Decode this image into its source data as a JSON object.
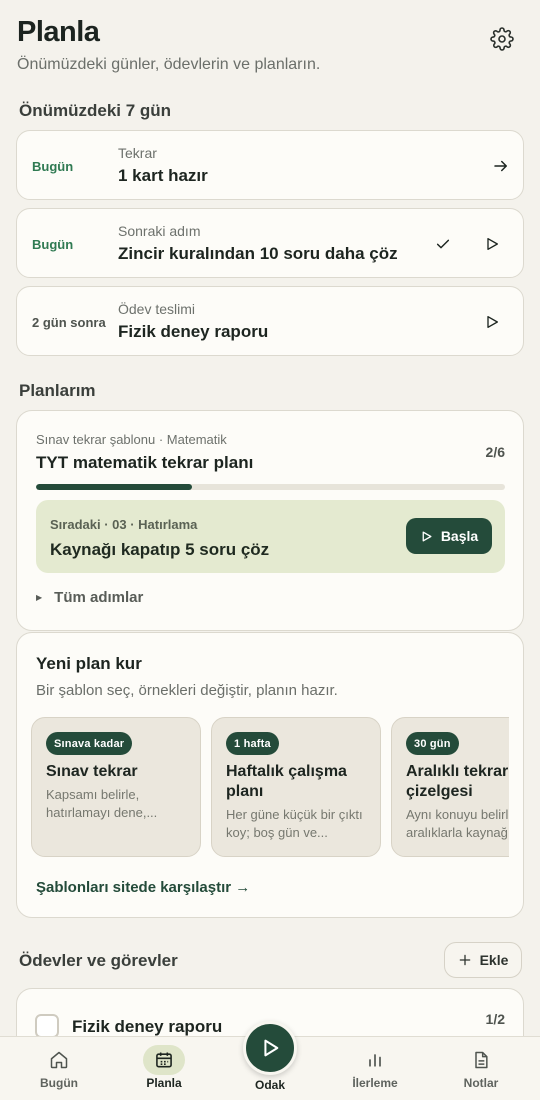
{
  "header": {
    "title": "Planla",
    "subtitle": "Önümüzdeki günler, ödevlerin ve planların.",
    "settings_icon": "gear-icon"
  },
  "upcoming": {
    "title": "Önümüzdeki 7 gün",
    "items": [
      {
        "when": "Bugün",
        "kicker": "Tekrar",
        "main": "1 kart hazır"
      },
      {
        "when": "Bugün",
        "kicker": "Sonraki adım",
        "main": "Zincir kuralından 10 soru daha çöz"
      },
      {
        "when": "2 gün sonra",
        "kicker": "Ödev teslimi",
        "main": "Fizik deney raporu"
      }
    ]
  },
  "plans": {
    "title": "Planlarım",
    "plan": {
      "kicker": "Sınav tekrar şablonu · Matematik",
      "name": "TYT matematik tekrar planı",
      "count": "2/6",
      "progress": 0.333,
      "next_kicker": "Sıradaki · 03 · Hatırlama",
      "next_main": "Kaynağı kapatıp 5 soru çöz",
      "start_label": "Başla",
      "all_steps_label": "Tüm adımlar"
    }
  },
  "new_plan": {
    "title": "Yeni plan kur",
    "subtitle": "Bir şablon seç, örnekleri değiştir, planın hazır.",
    "templates": [
      {
        "badge": "Sınava kadar",
        "name": "Sınav tekrar",
        "desc": "Kapsamı belirle, hatırlamayı dene,..."
      },
      {
        "badge": "1 hafta",
        "name": "Haftalık çalışma planı",
        "desc": "Her güne küçük bir çıktı koy; boş gün ve..."
      },
      {
        "badge": "30 gün",
        "name": "Aralıklı tekrar çizelgesi",
        "desc": "Aynı konuyu belirli aralıklarla kaynağı..."
      }
    ],
    "compare_label": "Şablonları sitede karşılaştır →"
  },
  "tasks": {
    "title": "Ödevler ve görevler",
    "add_label": "Ekle",
    "items": [
      {
        "name": "Fizik deney raporu",
        "count": "1/2"
      }
    ]
  },
  "nav": {
    "items": [
      {
        "label": "Bugün",
        "icon": "home-icon"
      },
      {
        "label": "Planla",
        "icon": "calendar-icon"
      },
      {
        "label": "Odak",
        "icon": "play-icon"
      },
      {
        "label": "İlerleme",
        "icon": "bar-chart-icon"
      },
      {
        "label": "Notlar",
        "icon": "notes-icon"
      }
    ],
    "active": "Planla"
  },
  "colors": {
    "accent": "#244b3a",
    "accent_green_text": "#2f7a52",
    "background": "#f4f2ec",
    "card": "#fdfcf8",
    "next_box": "#e4ead0"
  }
}
